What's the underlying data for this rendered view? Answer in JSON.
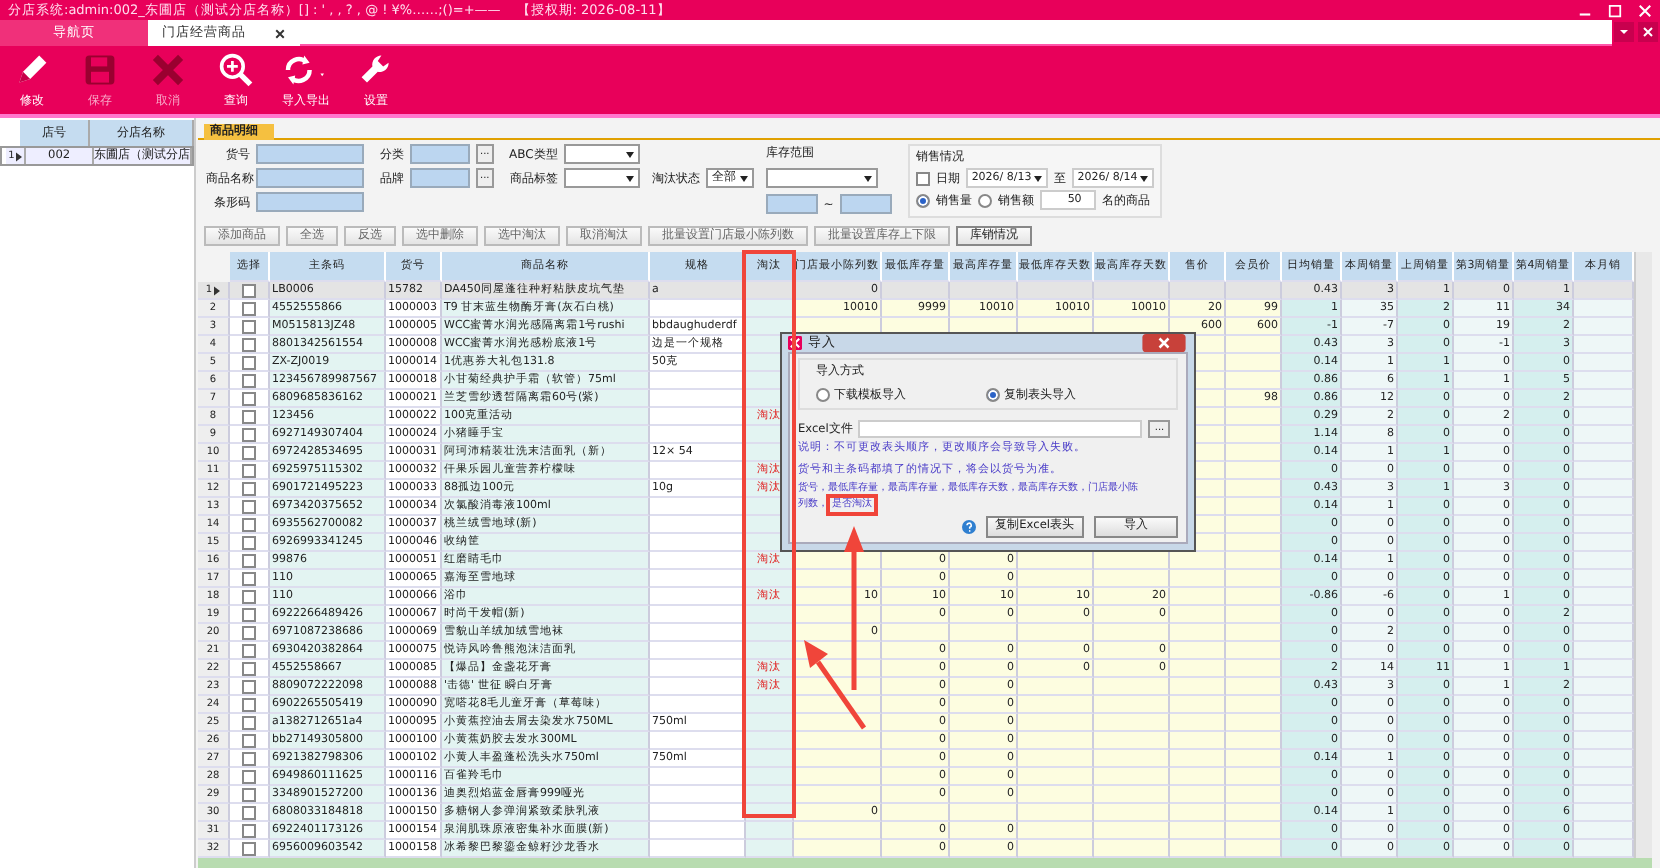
{
  "title_bar": {
    "title": "分店系统:admin:002_东圃店（测试分店名称）[] : ' , , ? , @ ! ¥%……;()=+——",
    "license": "【授权期: 2026-08-11】"
  },
  "tabs": [
    {
      "label": "导航页",
      "selected": false,
      "closable": false
    },
    {
      "label": "门店经营商品",
      "selected": true,
      "closable": true
    }
  ],
  "toolbar": [
    {
      "label": "修改",
      "kind": "edit",
      "disabled": false
    },
    {
      "label": "保存",
      "kind": "save",
      "disabled": true
    },
    {
      "label": "取消",
      "kind": "cancel",
      "disabled": true
    },
    {
      "label": "查询",
      "kind": "query",
      "disabled": false
    },
    {
      "label": "导入导出",
      "kind": "import",
      "disabled": false
    },
    {
      "label": "设置",
      "kind": "settings",
      "disabled": false
    }
  ],
  "store_list": {
    "columns": [
      "店号",
      "分店名称"
    ],
    "rows": [
      {
        "no": "1",
        "selected": true,
        "store_no": "002",
        "name": "东圃店（测试分店"
      }
    ]
  },
  "section_tab": "商品明细",
  "filters": {
    "item_no": "货号",
    "item_name": "商品名称",
    "barcode": "条形码",
    "category": "分类",
    "brand": "品牌",
    "abc_type": "ABC类型",
    "item_tag": "商品标签",
    "browse": "...",
    "status_label": "淘汰状态",
    "status_value": "全部",
    "stock_range": "库存范围",
    "range_sep": "~",
    "sales": {
      "title": "销售情况",
      "date_checked": false,
      "date_label": "日期",
      "date_from": "2026/ 8/13",
      "date_to_label": "至",
      "date_to": "2026/ 8/14",
      "modes": [
        {
          "label": "销售量",
          "selected": true
        },
        {
          "label": "销售额",
          "selected": false
        }
      ],
      "top_n": "50",
      "suffix": "名的商品"
    }
  },
  "actions": [
    "添加商品",
    "全选",
    "反选",
    "选中删除",
    "选中淘汰",
    "取消淘汰",
    "批量设置门店最小陈列数",
    "批量设置库存上下限",
    "库销情况"
  ],
  "table": {
    "columns": [
      "选择",
      "主条码",
      "货号",
      "商品名称",
      "规格",
      "淘汰",
      "门店最小陈列数",
      "最低库存量",
      "最高库存量",
      "最低库存天数",
      "最高库存天数",
      "售价",
      "会员价",
      "日均销量",
      "本周销量",
      "上周销量",
      "第3周销量",
      "第4周销量",
      "本月销"
    ],
    "rows": [
      {
        "no": "1",
        "selected": true,
        "checked": false,
        "barcode": "LB0006",
        "code": "15782",
        "name": "DA450同屋蓬往种籽粘肤皮坑气垫",
        "spec": "a",
        "min_display": "0",
        "daily_avg": "0.43",
        "this_week": "3",
        "last_week": "1",
        "week_3": "0",
        "week_4": "1"
      },
      {
        "no": "2",
        "selected": false,
        "checked": false,
        "barcode": "4552555866",
        "code": "1000003",
        "name": "T9 甘末蓝生物酶牙膏(灰石白桃)",
        "min_display": "10010",
        "min_stock": "9999",
        "max_stock": "10010",
        "min_days": "10010",
        "max_days": "10010",
        "price": "20",
        "member_price": "99",
        "daily_avg": "1",
        "this_week": "35",
        "last_week": "2",
        "week_3": "11",
        "week_4": "34"
      },
      {
        "no": "3",
        "selected": false,
        "checked": false,
        "barcode": "M0515813JZ48",
        "code": "1000005",
        "name": "WCC蜜菁水润光感隔离霜1号rushi",
        "spec": "bbdaughuderdf",
        "price": "600",
        "member_price": "600",
        "daily_avg": "-1",
        "this_week": "-7",
        "last_week": "0",
        "week_3": "19",
        "week_4": "2"
      },
      {
        "no": "4",
        "selected": false,
        "checked": false,
        "barcode": "8801342561554",
        "code": "1000008",
        "name": "WCC蜜菁水润光感粉底液1号",
        "spec": "边是一个规格",
        "daily_avg": "0.43",
        "this_week": "3",
        "last_week": "0",
        "week_3": "-1",
        "week_4": "3"
      },
      {
        "no": "5",
        "selected": false,
        "checked": false,
        "barcode": "ZX-ZJ0019",
        "code": "1000014",
        "name": "1优惠券大礼包131.8",
        "spec": "50克",
        "daily_avg": "0.14",
        "this_week": "1",
        "last_week": "1",
        "week_3": "0",
        "week_4": "0"
      },
      {
        "no": "6",
        "selected": false,
        "checked": false,
        "barcode": "123456789987567",
        "code": "1000018",
        "name": "小甘菊经典护手霜（软管）75ml",
        "daily_avg": "0.86",
        "this_week": "6",
        "last_week": "1",
        "week_3": "1",
        "week_4": "5"
      },
      {
        "no": "7",
        "selected": false,
        "checked": false,
        "barcode": "6809685836162",
        "code": "1000021",
        "name": "兰芝雪纱透皙隔离霜60号(紫)",
        "member_price": "98",
        "daily_avg": "0.86",
        "this_week": "12",
        "last_week": "0",
        "week_3": "0",
        "week_4": "2"
      },
      {
        "no": "8",
        "selected": false,
        "checked": false,
        "barcode": "123456",
        "code": "1000022",
        "name": "100克重活动",
        "status": "淘汰",
        "daily_avg": "0.29",
        "this_week": "2",
        "last_week": "0",
        "week_3": "2",
        "week_4": "0"
      },
      {
        "no": "9",
        "selected": false,
        "checked": false,
        "barcode": "6927149307404",
        "code": "1000024",
        "name": "小猪睡手宝",
        "daily_avg": "1.14",
        "this_week": "8",
        "last_week": "0",
        "week_3": "0",
        "week_4": "0"
      },
      {
        "no": "10",
        "selected": false,
        "checked": false,
        "barcode": "6972428534695",
        "code": "1000031",
        "name": "阿珂沛精装壮洗末洁面乳（新）",
        "spec": "12× 54",
        "daily_avg": "0.14",
        "this_week": "1",
        "last_week": "1",
        "week_3": "0",
        "week_4": "0"
      },
      {
        "no": "11",
        "selected": false,
        "checked": false,
        "barcode": "6925975115302",
        "code": "1000032",
        "name": "仟果乐园儿童营养柠檬味",
        "status": "淘汰",
        "daily_avg": "0",
        "this_week": "0",
        "last_week": "0",
        "week_3": "0",
        "week_4": "0"
      },
      {
        "no": "12",
        "selected": false,
        "checked": false,
        "barcode": "6901721495223",
        "code": "1000033",
        "name": "88孤边100元",
        "spec": "10g",
        "status": "淘汰",
        "daily_avg": "0.43",
        "this_week": "3",
        "last_week": "1",
        "week_3": "3",
        "week_4": "0"
      },
      {
        "no": "13",
        "selected": false,
        "checked": false,
        "barcode": "6973420375652",
        "code": "1000034",
        "name": "次氯酸消毒液100ml",
        "daily_avg": "0.14",
        "this_week": "1",
        "last_week": "0",
        "week_3": "0",
        "week_4": "0"
      },
      {
        "no": "14",
        "selected": false,
        "checked": false,
        "barcode": "6935562700082",
        "code": "1000037",
        "name": "桃兰绒雪地球(新)",
        "daily_avg": "0",
        "this_week": "0",
        "last_week": "0",
        "week_3": "0",
        "week_4": "0"
      },
      {
        "no": "15",
        "selected": false,
        "checked": false,
        "barcode": "6926993341245",
        "code": "1000046",
        "name": "收纳筐",
        "daily_avg": "0",
        "this_week": "0",
        "last_week": "0",
        "week_3": "0",
        "week_4": "0"
      },
      {
        "no": "16",
        "selected": false,
        "checked": false,
        "barcode": "99876",
        "code": "1000051",
        "name": "红磨睛毛巾",
        "status": "淘汰",
        "min_stock": "0",
        "max_stock": "0",
        "daily_avg": "0.14",
        "this_week": "1",
        "last_week": "0",
        "week_3": "0",
        "week_4": "0"
      },
      {
        "no": "17",
        "selected": false,
        "checked": false,
        "barcode": "110",
        "code": "1000065",
        "name": "嘉海至雪地球",
        "min_stock": "0",
        "max_stock": "0",
        "daily_avg": "0",
        "this_week": "0",
        "last_week": "0",
        "week_3": "0",
        "week_4": "0"
      },
      {
        "no": "18",
        "selected": false,
        "checked": false,
        "barcode": "110",
        "code": "1000066",
        "name": "浴巾",
        "status": "淘汰",
        "min_display": "10",
        "min_stock": "10",
        "max_stock": "10",
        "min_days": "10",
        "max_days": "20",
        "daily_avg": "-0.86",
        "this_week": "-6",
        "last_week": "0",
        "week_3": "1",
        "week_4": "0"
      },
      {
        "no": "19",
        "selected": false,
        "checked": false,
        "barcode": "6922266489426",
        "code": "1000067",
        "name": "时尚干发帽(新)",
        "min_stock": "0",
        "max_stock": "0",
        "min_days": "0",
        "max_days": "0",
        "daily_avg": "0",
        "this_week": "0",
        "last_week": "0",
        "week_3": "0",
        "week_4": "2"
      },
      {
        "no": "20",
        "selected": false,
        "checked": false,
        "barcode": "6971087238686",
        "code": "1000069",
        "name": "雪貌山羊绒加绒雪地袜",
        "min_display": "0",
        "daily_avg": "0",
        "this_week": "2",
        "last_week": "0",
        "week_3": "0",
        "week_4": "0"
      },
      {
        "no": "21",
        "selected": false,
        "checked": false,
        "barcode": "6930420382864",
        "code": "1000075",
        "name": "悦诗风吟鲁熊泡沫洁面乳",
        "min_stock": "0",
        "max_stock": "0",
        "min_days": "0",
        "max_days": "0",
        "daily_avg": "0",
        "this_week": "0",
        "last_week": "0",
        "week_3": "0",
        "week_4": "0"
      },
      {
        "no": "22",
        "selected": false,
        "checked": false,
        "barcode": "4552558667",
        "code": "1000085",
        "name": "【爆品】金盏花牙膏",
        "status": "淘汰",
        "min_stock": "0",
        "max_stock": "0",
        "min_days": "0",
        "max_days": "0",
        "daily_avg": "2",
        "this_week": "14",
        "last_week": "11",
        "week_3": "1",
        "week_4": "1"
      },
      {
        "no": "23",
        "selected": false,
        "checked": false,
        "barcode": "8809072222098",
        "code": "1000088",
        "name": "'击德' 世征 瞬白牙膏",
        "status": "淘汰",
        "min_stock": "0",
        "max_stock": "0",
        "daily_avg": "0.43",
        "this_week": "3",
        "last_week": "0",
        "week_3": "1",
        "week_4": "2"
      },
      {
        "no": "24",
        "selected": false,
        "checked": false,
        "barcode": "6902265505419",
        "code": "1000090",
        "name": "宽嗒花8毛儿童牙膏（草莓味）",
        "min_stock": "0",
        "max_stock": "0",
        "daily_avg": "0",
        "this_week": "0",
        "last_week": "0",
        "week_3": "0",
        "week_4": "0"
      },
      {
        "no": "25",
        "selected": false,
        "checked": false,
        "barcode": "a1382712651a4",
        "code": "1000095",
        "name": "小黄蕉控油去屑去染发水750ML",
        "spec": "750ml",
        "min_stock": "0",
        "max_stock": "0",
        "daily_avg": "0",
        "this_week": "0",
        "last_week": "0",
        "week_3": "0",
        "week_4": "0"
      },
      {
        "no": "26",
        "selected": false,
        "checked": false,
        "barcode": "bb27149305800",
        "code": "1000100",
        "name": "小黄蕉奶胶去发水300ML",
        "min_stock": "0",
        "max_stock": "0",
        "daily_avg": "0",
        "this_week": "0",
        "last_week": "0",
        "week_3": "0",
        "week_4": "0"
      },
      {
        "no": "27",
        "selected": false,
        "checked": false,
        "barcode": "6921382798306",
        "code": "1000102",
        "name": "小黄人丰盈蓬松洗头水750ml",
        "spec": "750ml",
        "min_stock": "0",
        "max_stock": "0",
        "daily_avg": "0.14",
        "this_week": "1",
        "last_week": "0",
        "week_3": "0",
        "week_4": "0"
      },
      {
        "no": "28",
        "selected": false,
        "checked": false,
        "barcode": "6949860111625",
        "code": "1000116",
        "name": "百雀羚毛巾",
        "min_stock": "0",
        "max_stock": "0",
        "daily_avg": "0",
        "this_week": "0",
        "last_week": "0",
        "week_3": "0",
        "week_4": "0"
      },
      {
        "no": "29",
        "selected": false,
        "checked": false,
        "barcode": "3348901527200",
        "code": "1000136",
        "name": "迪奥烈焰蓝金唇膏999哑光",
        "min_stock": "0",
        "max_stock": "0",
        "daily_avg": "0",
        "this_week": "0",
        "last_week": "0",
        "week_3": "0",
        "week_4": "0"
      },
      {
        "no": "30",
        "selected": false,
        "checked": false,
        "barcode": "6808033184818",
        "code": "1000150",
        "name": "多糖钢人参弹润紧致柔肤乳液",
        "min_display": "0",
        "daily_avg": "0.14",
        "this_week": "1",
        "last_week": "0",
        "week_3": "0",
        "week_4": "6"
      },
      {
        "no": "31",
        "selected": false,
        "checked": false,
        "barcode": "6922401173126",
        "code": "1000154",
        "name": "泉润肌珠原液密集补水面膜(新)",
        "min_stock": "0",
        "max_stock": "0",
        "daily_avg": "0",
        "this_week": "0",
        "last_week": "0",
        "week_3": "0",
        "week_4": "0"
      },
      {
        "no": "32",
        "selected": false,
        "checked": false,
        "barcode": "6956009603542",
        "code": "1000158",
        "name": "冰希黎巴黎鎏金鲸籽沙龙香水",
        "min_stock": "0",
        "max_stock": "0",
        "daily_avg": "0",
        "this_week": "0",
        "last_week": "0",
        "week_3": "0",
        "week_4": "0"
      }
    ]
  },
  "dialog": {
    "title": "导入",
    "group": "导入方式",
    "modes": [
      {
        "label": "下载模板导入",
        "selected": false
      },
      {
        "label": "复制表头导入",
        "selected": true
      }
    ],
    "file_label": "Excel文件",
    "browse": "...",
    "note": "说明：不可更改表头顺序，更改顺序会导致导入失败。",
    "rule": "货号和主条码都填了的情况下，将会以货号为准。",
    "fields": [
      "货号，最低库存量，最高库存量，最低库存天数，最高库存天数，门店最小陈",
      "列数，"
    ],
    "highlighted_field": "是否淘汰",
    "buttons": [
      "复制Excel表头",
      "导入"
    ]
  }
}
